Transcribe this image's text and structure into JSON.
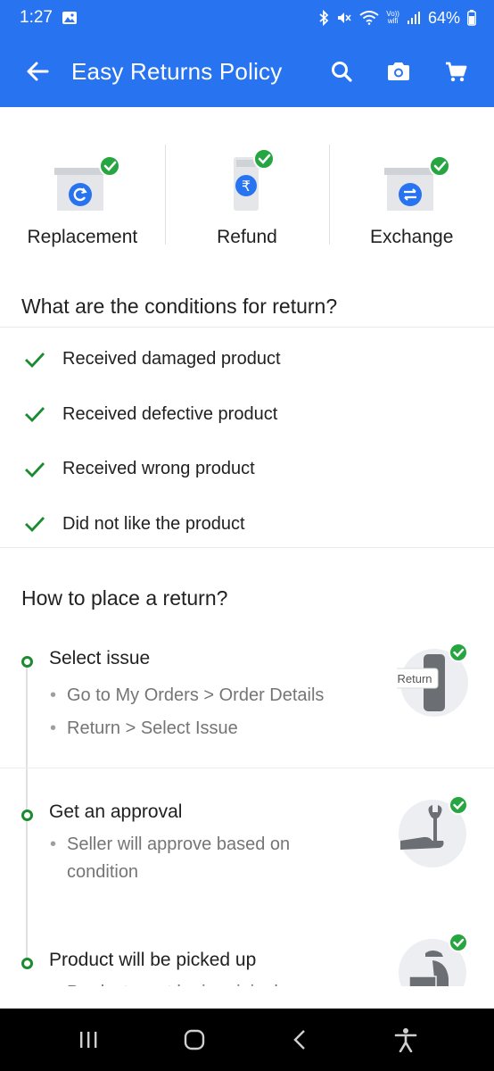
{
  "status_bar": {
    "time": "1:27",
    "battery": "64%",
    "volte": "Vo))",
    "wifi_label": "wifi"
  },
  "app_bar": {
    "title": "Easy Returns Policy"
  },
  "policy_types": [
    {
      "label": "Replacement"
    },
    {
      "label": "Refund"
    },
    {
      "label": "Exchange"
    }
  ],
  "conditions": {
    "title": "What are the conditions for return?",
    "items": [
      "Received damaged product",
      "Received defective product",
      "Received wrong product",
      "Did not like the product"
    ]
  },
  "steps": {
    "title": "How to place a return?",
    "items": [
      {
        "title": "Select issue",
        "bullets": [
          "Go to My Orders > Order Details",
          "Return > Select Issue"
        ],
        "illustration_label": "Return"
      },
      {
        "title": "Get an approval",
        "bullets": [
          "Seller will approve based on condition"
        ]
      },
      {
        "title": "Product will be picked up",
        "bullets": [
          "Product must be in original"
        ]
      }
    ]
  },
  "colors": {
    "brand_blue": "#2874f0",
    "success_green": "#1a8c2f",
    "check_badge": "#26a541"
  }
}
